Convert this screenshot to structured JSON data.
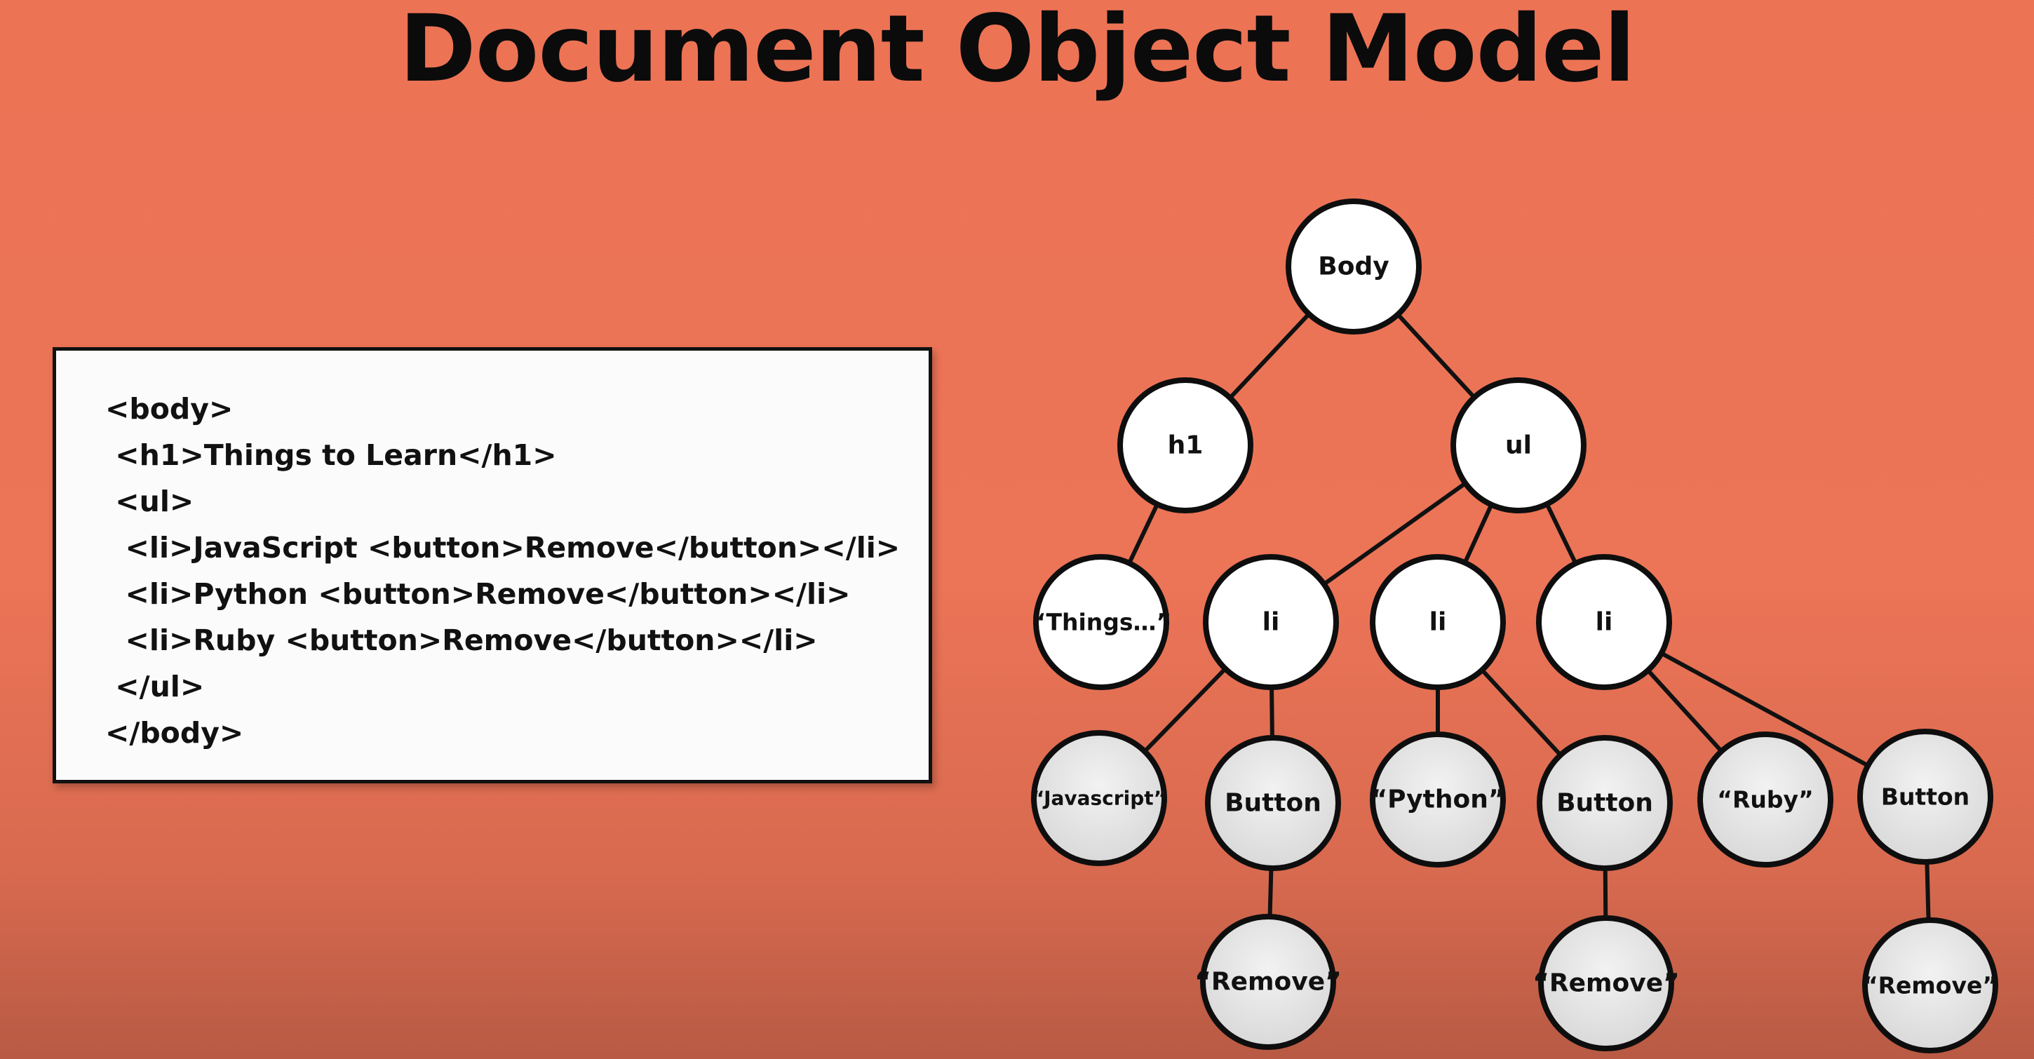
{
  "title": "Document Object Model",
  "code_snippet": {
    "lines": [
      "<body>",
      " <h1>Things to Learn</h1>",
      " <ul>",
      "  <li>JavaScript <button>Remove</button></li>",
      "  <li>Python <button>Remove</button></li>",
      "  <li>Ruby <button>Remove</button></li>",
      " </ul>",
      "</body>"
    ]
  },
  "tree": {
    "nodes": [
      {
        "id": "body",
        "label": "Body"
      },
      {
        "id": "h1",
        "label": "h1"
      },
      {
        "id": "ul",
        "label": "ul"
      },
      {
        "id": "things",
        "label": "“Things…”"
      },
      {
        "id": "li1",
        "label": "li"
      },
      {
        "id": "li2",
        "label": "li"
      },
      {
        "id": "li3",
        "label": "li"
      },
      {
        "id": "js",
        "label": "“Javascript”"
      },
      {
        "id": "btn1",
        "label": "Button"
      },
      {
        "id": "python",
        "label": "“Python”"
      },
      {
        "id": "btn2",
        "label": "Button"
      },
      {
        "id": "ruby",
        "label": "“Ruby”"
      },
      {
        "id": "btn3",
        "label": "Button"
      },
      {
        "id": "remove1",
        "label": "“Remove”"
      },
      {
        "id": "remove2",
        "label": "“Remove”"
      },
      {
        "id": "remove3",
        "label": "“Remove”"
      }
    ],
    "edges": [
      [
        "body",
        "h1"
      ],
      [
        "body",
        "ul"
      ],
      [
        "h1",
        "things"
      ],
      [
        "ul",
        "li1"
      ],
      [
        "ul",
        "li2"
      ],
      [
        "ul",
        "li3"
      ],
      [
        "li1",
        "js"
      ],
      [
        "li1",
        "btn1"
      ],
      [
        "li2",
        "python"
      ],
      [
        "li2",
        "btn2"
      ],
      [
        "li3",
        "ruby"
      ],
      [
        "li3",
        "btn3"
      ],
      [
        "btn1",
        "remove1"
      ],
      [
        "btn2",
        "remove2"
      ],
      [
        "btn3",
        "remove3"
      ]
    ]
  },
  "colors": {
    "background": "#ed7355",
    "node_fill_light": "#ffffff",
    "node_fill_shaded": "#e6e6e6",
    "stroke": "#111111"
  }
}
